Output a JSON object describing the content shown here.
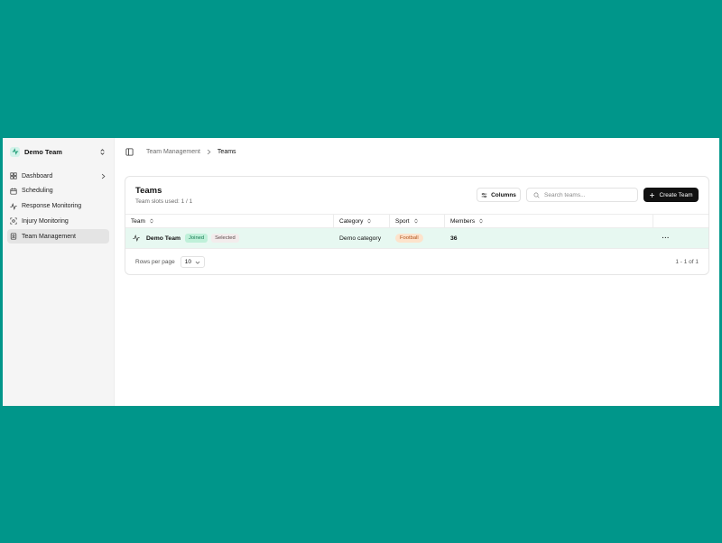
{
  "sidebar": {
    "team_name": "Demo Team",
    "items": [
      {
        "label": "Dashboard",
        "icon": "grid-icon",
        "has_chevron": true
      },
      {
        "label": "Scheduling",
        "icon": "calendar-icon"
      },
      {
        "label": "Response Monitoring",
        "icon": "activity-icon"
      },
      {
        "label": "Injury Monitoring",
        "icon": "scan-icon"
      },
      {
        "label": "Team Management",
        "icon": "clipboard-icon",
        "active": true
      }
    ]
  },
  "breadcrumb": {
    "parent": "Team Management",
    "current": "Teams"
  },
  "card": {
    "title": "Teams",
    "subtitle": "Team slots used: 1 / 1",
    "columns_button": "Columns",
    "search_placeholder": "Search teams...",
    "create_button": "Create Team"
  },
  "table": {
    "headers": [
      "Team",
      "Category",
      "Sport",
      "Members"
    ],
    "rows": [
      {
        "team": "Demo Team",
        "badges": [
          "Joined",
          "Selected"
        ],
        "category": "Demo category",
        "sport": "Football",
        "members": "36",
        "actions": "···"
      }
    ],
    "rows_per_page_label": "Rows per page",
    "rows_per_page_value": "10",
    "pagination": "1 - 1 of 1"
  },
  "colors": {
    "background": "#00968a",
    "selected_row": "#e7f8f1",
    "joined_badge": "#bff0d9",
    "sport_badge": "#fde3cc",
    "primary_button": "#111111"
  }
}
